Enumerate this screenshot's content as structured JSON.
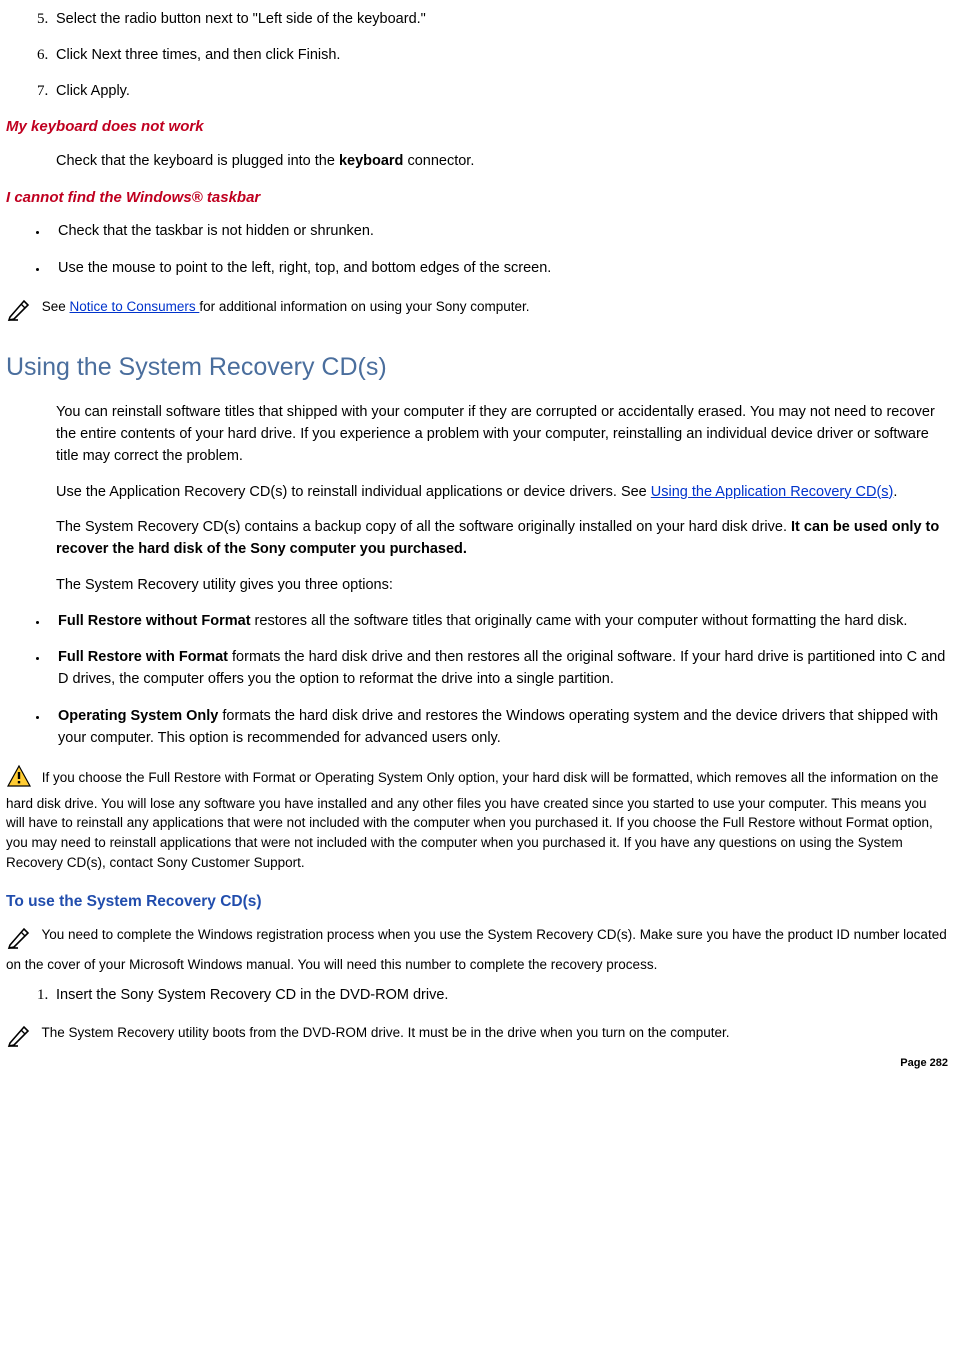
{
  "list1": {
    "i5": "Select the radio button next to \"Left side of the keyboard.\"",
    "i6": "Click Next three times, and then click Finish.",
    "i7": "Click Apply."
  },
  "h_keyboard": "My keyboard does not work",
  "p_keyboard_pre": "Check that the keyboard is plugged into the ",
  "p_keyboard_bold": "keyboard",
  "p_keyboard_post": " connector.",
  "h_taskbar": "I cannot find the Windows® taskbar",
  "list_taskbar": {
    "b1": "Check that the taskbar is not hidden or shrunken.",
    "b2": "Use the mouse to point to the left, right, top, and bottom edges of the screen."
  },
  "note_consumers_pre": " See ",
  "note_consumers_link": "Notice to Consumers ",
  "note_consumers_post": "for additional information on using your Sony computer.",
  "h_recovery": "Using the System Recovery CD(s)",
  "p_rec_1": "You can reinstall software titles that shipped with your computer if they are corrupted or accidentally erased. You may not need to recover the entire contents of your hard drive. If you experience a problem with your computer, reinstalling an individual device driver or software title may correct the problem.",
  "p_rec_2_pre": "Use the Application Recovery CD(s) to reinstall individual applications or device drivers. See ",
  "p_rec_2_link": "Using the Application Recovery CD(s)",
  "p_rec_2_post": ".",
  "p_rec_3_pre": "The System Recovery CD(s) contains a backup copy of all the software originally installed on your hard disk drive. ",
  "p_rec_3_bold": "It can be used only to recover the hard disk of the Sony computer you purchased.",
  "p_rec_4": "The System Recovery utility gives you three options:",
  "options": {
    "o1_b": "Full Restore without Format",
    "o1_t": " restores all the software titles that originally came with your computer without formatting the hard disk.",
    "o2_b": "Full Restore with Format",
    "o2_t": " formats the hard disk drive and then restores all the original software. If your hard drive is partitioned into C and D drives, the computer offers you the option to reformat the drive into a single partition.",
    "o3_b": "Operating System Only",
    "o3_t": " formats the hard disk drive and restores the Windows operating system and the device drivers that shipped with your computer. This option is recommended for advanced users only."
  },
  "warn_text": " If you choose the Full Restore with Format or Operating System Only option, your hard disk will be formatted, which removes all the information on the hard disk drive. You will lose any software you have installed and any other files you have created since you started to use your computer. This means you will have to reinstall any applications that were not included with the computer when you purchased it. If you choose the Full Restore without Format option, you may need to reinstall applications that were not included with the computer when you purchased it. If you have any questions on using the System Recovery CD(s), contact Sony Customer Support.",
  "h_touse": "To use the System Recovery CD(s)",
  "note_reg": " You need to complete the Windows registration process when you use the System Recovery CD(s). Make sure you have the product ID number located on the cover of your Microsoft Windows manual. You will need this number to complete the recovery process.",
  "step_insert": "Insert the Sony System Recovery CD in the DVD-ROM drive.",
  "note_boot": " The System Recovery utility boots from the DVD-ROM drive. It must be in the drive when you turn on the computer.",
  "page_num": "Page 282"
}
